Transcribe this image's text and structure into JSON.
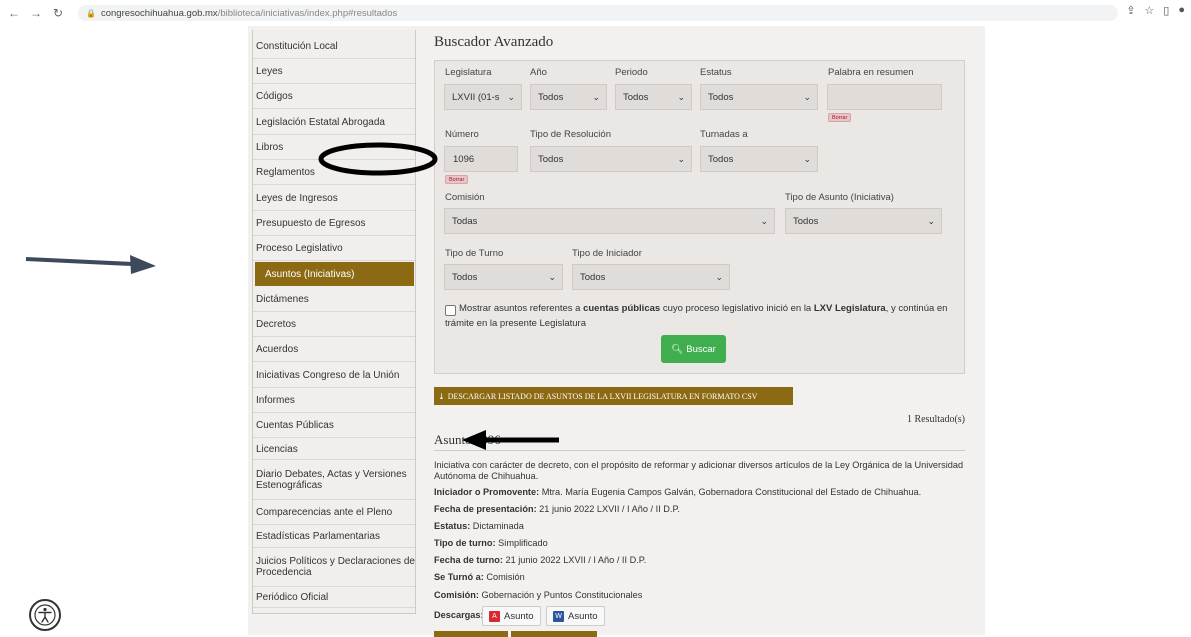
{
  "browser": {
    "url_host": "congresochihuahua.gob.mx",
    "url_path": "/biblioteca/iniciativas/index.php#resultados"
  },
  "sidebar": {
    "items": [
      {
        "label": "Constitución Local",
        "active": false
      },
      {
        "label": "Leyes",
        "active": false
      },
      {
        "label": "Códigos",
        "active": false
      },
      {
        "label": "Legislación Estatal Abrogada",
        "active": false
      },
      {
        "label": "Libros",
        "active": false
      },
      {
        "label": "Reglamentos",
        "active": false
      },
      {
        "label": "Leyes de Ingresos",
        "active": false
      },
      {
        "label": "Presupuesto de Egresos",
        "active": false
      },
      {
        "label": "Proceso Legislativo",
        "active": false
      },
      {
        "label": "Asuntos (Iniciativas)",
        "active": true
      },
      {
        "label": "Dictámenes",
        "active": false
      },
      {
        "label": "Decretos",
        "active": false
      },
      {
        "label": "Acuerdos",
        "active": false
      },
      {
        "label": "Iniciativas Congreso de la Unión",
        "active": false
      },
      {
        "label": "Informes",
        "active": false
      },
      {
        "label": "Cuentas Públicas",
        "active": false
      },
      {
        "label": "Licencias",
        "active": false
      },
      {
        "label": "Diario Debates, Actas y Versiones Estenográficas",
        "active": false
      },
      {
        "label": "Comparecencias ante el Pleno",
        "active": false
      },
      {
        "label": "Estadísticas Parlamentarias",
        "active": false
      },
      {
        "label": "Juicios Políticos y Declaraciones de Procedencia",
        "active": false
      },
      {
        "label": "Periódico Oficial",
        "active": false
      }
    ]
  },
  "main": {
    "title": "Buscador Avanzado",
    "filters": {
      "legislatura": {
        "label": "Legislatura",
        "value": "LXVII (01-s"
      },
      "anio": {
        "label": "Año",
        "value": "Todos"
      },
      "periodo": {
        "label": "Periodo",
        "value": "Todos"
      },
      "estatus": {
        "label": "Estatus",
        "value": "Todos"
      },
      "palabra": {
        "label": "Palabra en resumen",
        "value": ""
      },
      "numero": {
        "label": "Número",
        "value": "1096"
      },
      "tipo_resolucion": {
        "label": "Tipo de Resolución",
        "value": "Todos"
      },
      "turnadas": {
        "label": "Turnadas a",
        "value": "Todos"
      },
      "comision": {
        "label": "Comisión",
        "value": "Todas"
      },
      "tipo_asunto": {
        "label": "Tipo de Asunto (Iniciativa)",
        "value": "Todos"
      },
      "tipo_turno": {
        "label": "Tipo de Turno",
        "value": "Todos"
      },
      "tipo_iniciador": {
        "label": "Tipo de Iniciador",
        "value": "Todos"
      }
    },
    "borrar_label": "Borrar",
    "checkbox": {
      "part1": "Mostrar asuntos referentes a ",
      "bold1": "cuentas públicas",
      "part2": " cuyo proceso legislativo inició en la ",
      "bold2": "LXV Legislatura",
      "part3": ", y continúa en",
      "line2": "trámite en la presente Legislatura"
    },
    "search_button": "Buscar",
    "csv_button": "DESCARGAR LISTADO DE ASUNTOS DE LA LXVII LEGISLATURA EN FORMATO CSV",
    "results_count": "1 Resultado(s)",
    "asunto": {
      "title": "Asunto 1096",
      "description": "Iniciativa con carácter de decreto, con el propósito de reformar y adicionar diversos artículos de la Ley Orgánica de la Universidad Autónoma de Chihuahua.",
      "iniciador_label": "Iniciador o Promovente:",
      "iniciador": " Mtra. María Eugenia Campos Galván, Gobernadora Constitucional del Estado de Chihuahua.",
      "fecha_presentacion_label": "Fecha de presentación:",
      "fecha_presentacion": " 21 junio 2022   LXVII / I Año / II D.P.",
      "estatus_label": "Estatus:",
      "estatus": " Dictaminada",
      "tipo_turno_label": "Tipo de turno:",
      "tipo_turno": " Simplificado",
      "fecha_turno_label": "Fecha de turno:",
      "fecha_turno": " 21 junio 2022   LXVII / I Año / II D.P.",
      "se_turno_label": "Se Turnó a:",
      "se_turno": " Comisión",
      "comision_label": "Comisión:",
      "comision": " Gobernación y Puntos Constitucionales",
      "descargas_label": "Descargas:",
      "download_pdf": "Asunto",
      "download_word": "Asunto"
    }
  },
  "colors": {
    "accent_gold": "#8c6a14",
    "buscar_green": "#3fae4f",
    "annotation_arrow": "#3d4a5c"
  }
}
